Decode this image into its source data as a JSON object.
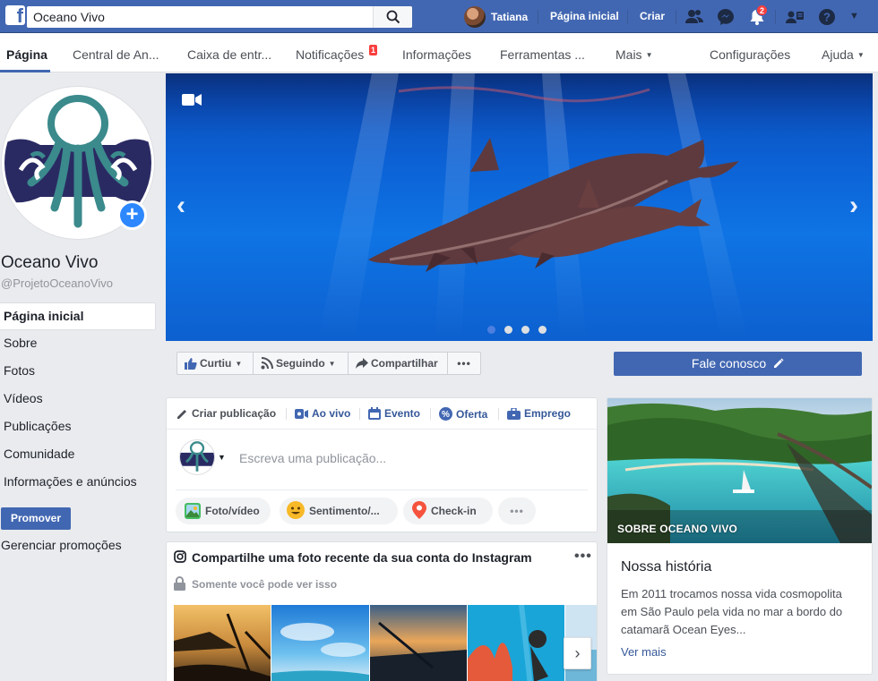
{
  "topbar": {
    "search_value": "Oceano Vivo",
    "user_name": "Tatiana",
    "home_label": "Página inicial",
    "create_label": "Criar",
    "notification_count": "2"
  },
  "tabs": [
    {
      "label": "Página"
    },
    {
      "label": "Central de An..."
    },
    {
      "label": "Caixa de entr..."
    },
    {
      "label": "Notificações",
      "badge": "1"
    },
    {
      "label": "Informações"
    },
    {
      "label": "Ferramentas ..."
    },
    {
      "label": "Mais"
    },
    {
      "label": "Configurações"
    },
    {
      "label": "Ajuda"
    }
  ],
  "page": {
    "name": "Oceano Vivo",
    "handle": "@ProjetoOceanoVivo"
  },
  "side_nav": [
    {
      "label": "Página inicial"
    },
    {
      "label": "Sobre"
    },
    {
      "label": "Fotos"
    },
    {
      "label": "Vídeos"
    },
    {
      "label": "Publicações"
    },
    {
      "label": "Comunidade"
    },
    {
      "label": "Informações e anúncios"
    }
  ],
  "promote_label": "Promover",
  "manage_promos_label": "Gerenciar promoções",
  "cover": {
    "slide_count": 4,
    "active_slide": 1
  },
  "actions": {
    "like_label": "Curtiu",
    "follow_label": "Seguindo",
    "share_label": "Compartilhar",
    "contact_label": "Fale conosco"
  },
  "composer": {
    "tabs": [
      {
        "label": "Criar publicação"
      },
      {
        "label": "Ao vivo"
      },
      {
        "label": "Evento"
      },
      {
        "label": "Oferta"
      },
      {
        "label": "Emprego"
      }
    ],
    "placeholder": "Escreva uma publicação...",
    "pills": [
      {
        "label": "Foto/vídeo"
      },
      {
        "label": "Sentimento/..."
      },
      {
        "label": "Check-in"
      }
    ]
  },
  "instagram": {
    "title": "Compartilhe uma foto recente da sua conta do Instagram",
    "subtitle": "Somente você pode ver isso"
  },
  "about": {
    "label": "Sobre Oceano Vivo",
    "heading": "Nossa história",
    "text": "Em 2011 trocamos nossa vida cosmopolita em São Paulo pela vida no mar a bordo do catamarã Ocean Eyes...",
    "more_label": "Ver mais"
  },
  "colors": {
    "brand_blue": "#4267b2",
    "link_blue": "#365899",
    "badge_red": "#fa3e3e"
  }
}
